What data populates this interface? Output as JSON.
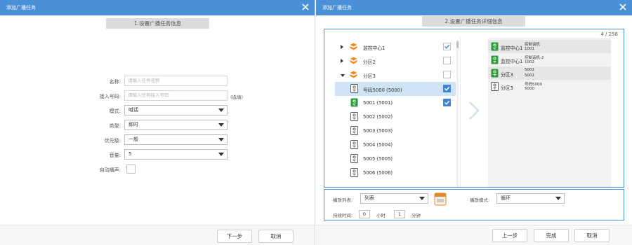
{
  "dialog1": {
    "title": "添加广播任务",
    "step": "1.设置广播任务信息",
    "form": {
      "name": {
        "label": "名称:",
        "placeholder": "请输入任务名称"
      },
      "number": {
        "label": "接入号码:",
        "placeholder": "请输入任务接入号码",
        "note": "(选填)"
      },
      "mode": {
        "label": "模式:",
        "value": "喊话"
      },
      "type": {
        "label": "类型:",
        "value": "即时"
      },
      "priority": {
        "label": "优先级:",
        "value": "一般"
      },
      "volume": {
        "label": "音量:",
        "value": "5"
      },
      "autostart": {
        "label": "自动播声:"
      }
    },
    "buttons": {
      "next": "下一步",
      "cancel": "取消"
    }
  },
  "dialog2": {
    "title": "添加广播任务",
    "step": "2.设置广播任务详细信息",
    "counter": "4 / 256",
    "tree": [
      {
        "label": "监控中心1",
        "kind": "group",
        "expanded": false,
        "checked": true
      },
      {
        "label": "分区2",
        "kind": "group",
        "expanded": false,
        "checked": false
      },
      {
        "label": "分区3",
        "kind": "group",
        "expanded": true,
        "checked": false
      },
      {
        "label": "号码5000 (5000)",
        "kind": "device",
        "checked": true,
        "selected": true
      },
      {
        "label": "5001 (5001)",
        "kind": "device-green",
        "checked": true
      },
      {
        "label": "5002 (5002)",
        "kind": "device"
      },
      {
        "label": "5003 (5003)",
        "kind": "device"
      },
      {
        "label": "5004 (5004)",
        "kind": "device"
      },
      {
        "label": "5005 (5005)",
        "kind": "device"
      },
      {
        "label": "5006 (5006)",
        "kind": "device"
      }
    ],
    "selected": [
      {
        "zone": "监控中心1",
        "name": "控制话机",
        "num": "1001",
        "green": true
      },
      {
        "zone": "监控中心1",
        "name": "控制话机-2",
        "num": "1002",
        "green": true
      },
      {
        "zone": "分区3",
        "name": "5001",
        "num": "5001",
        "green": true
      },
      {
        "zone": "分区3",
        "name": "号码5000",
        "num": "5000",
        "green": false
      }
    ],
    "options": {
      "playlist_label": "播放列表:",
      "playlist_value": "列表",
      "playmode_label": "播放模式:",
      "playmode_value": "循环",
      "duration_label": "持续时间:",
      "hours_value": "0",
      "hours_unit": "小时",
      "minutes_value": "1",
      "minutes_unit": "分钟"
    },
    "buttons": {
      "prev": "上一步",
      "finish": "完成",
      "cancel": "取消"
    }
  },
  "colors": {
    "titlebar": "#4a90d9",
    "selected_row": "#cfe4f7",
    "device_green": "#2e9b3e",
    "zone_orange": "#f08a24"
  }
}
